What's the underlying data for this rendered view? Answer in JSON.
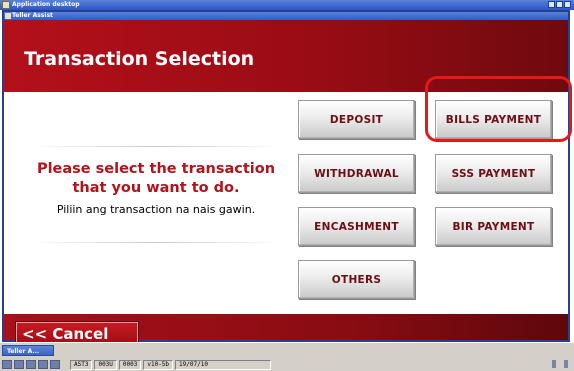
{
  "os": {
    "title": "Application desktop",
    "taskbar_button": "Teller A..."
  },
  "window": {
    "title": "Teller Assist"
  },
  "header": {
    "title": "Transaction Selection"
  },
  "prompt": {
    "line1": "Please select the transaction",
    "line2": "that you want to do.",
    "subtitle": "Piliin ang transaction na nais gawin."
  },
  "buttons": {
    "deposit": "DEPOSIT",
    "bills_payment": "BILLS PAYMENT",
    "withdrawal": "WITHDRAWAL",
    "sss_payment": "SSS PAYMENT",
    "encashment": "ENCASHMENT",
    "bir_payment": "BIR PAYMENT",
    "others": "OTHERS"
  },
  "footer": {
    "cancel_label": "<< Cancel"
  },
  "status": {
    "fields": [
      "AST3",
      "003U",
      "0003",
      "v10-5b",
      "19/07/10"
    ]
  },
  "colors": {
    "brand_red": "#b3101a",
    "button_text": "#6d0e13",
    "highlight": "#e21a1a"
  }
}
